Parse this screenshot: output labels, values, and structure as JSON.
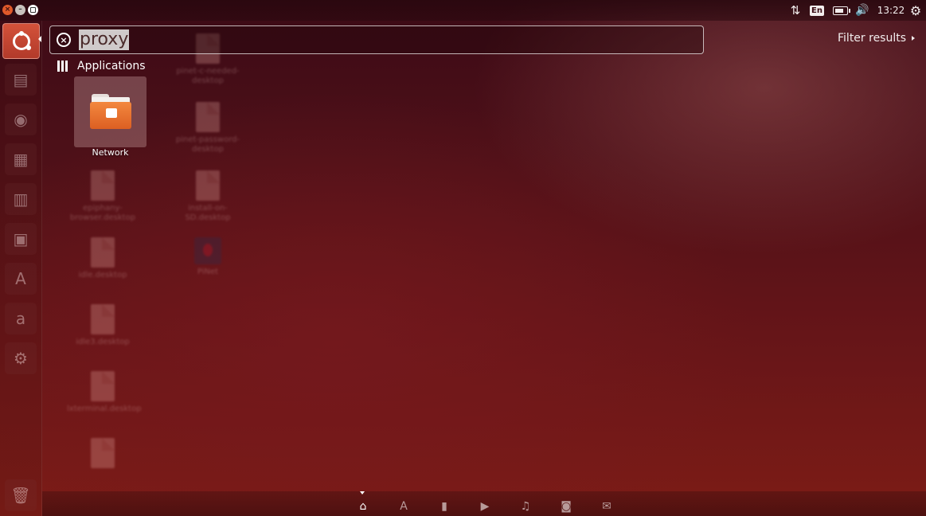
{
  "top_panel": {
    "clock": "13:22",
    "keyboard_layout": "En",
    "icons": [
      "network-icon",
      "keyboard-layout-icon",
      "battery-icon",
      "volume-icon",
      "session-gear-icon"
    ]
  },
  "window_controls": [
    "close-icon",
    "minimize-icon",
    "maximize-icon"
  ],
  "launcher": {
    "items": [
      "ubuntu-dash-icon",
      "files-icon",
      "firefox-icon",
      "writer-icon",
      "calc-icon",
      "impress-icon",
      "software-center-icon",
      "amazon-icon",
      "system-settings-icon",
      "trash-icon"
    ],
    "amazon_glyph": "a"
  },
  "dash": {
    "search": {
      "value": "proxy"
    },
    "filter_label": "Filter results",
    "category": {
      "label": "Applications"
    },
    "results": [
      {
        "label": "Network",
        "icon": "network-folder-icon"
      }
    ]
  },
  "background_files": [
    {
      "caption": "pinet-c-needed-desktop"
    },
    {
      "caption": "pinet-password-desktop"
    },
    {
      "caption": "epiphany-browser.desktop"
    },
    {
      "caption": "install-on-SD.desktop"
    },
    {
      "caption": "idle.desktop"
    },
    {
      "caption": "PiNet"
    },
    {
      "caption": "idle3.desktop"
    },
    {
      "caption": "lxterminal.desktop"
    }
  ],
  "lenses": [
    "home-lens-icon",
    "applications-lens-icon",
    "files-lens-icon",
    "video-lens-icon",
    "music-lens-icon",
    "photos-lens-icon",
    "social-lens-icon"
  ],
  "colors": {
    "accent": "#dd4814",
    "background": "#5a1218"
  }
}
